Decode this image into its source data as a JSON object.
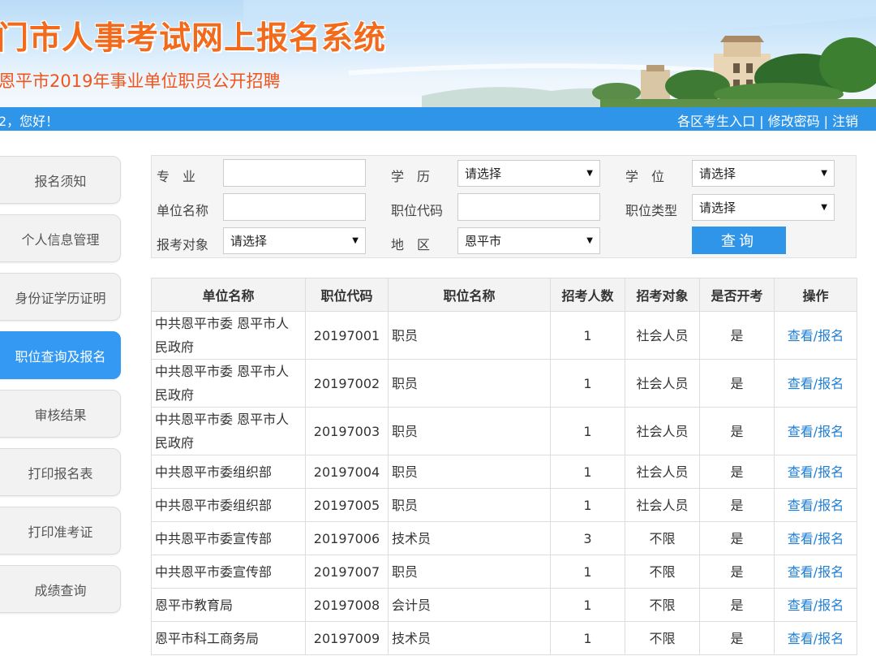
{
  "header": {
    "title": "门市人事考试网上报名系统",
    "subtitle": "恩平市2019年事业单位职员公开招聘"
  },
  "statusbar": {
    "greeting": "2，您好！",
    "links": [
      "各区考生入口",
      "修改密码",
      "注销"
    ],
    "separator": "|"
  },
  "sidebar": {
    "items": [
      {
        "label": "报名须知"
      },
      {
        "label": "个人信息管理"
      },
      {
        "label": "身份证学历证明"
      },
      {
        "label": "职位查询及报名",
        "active": true
      },
      {
        "label": "审核结果"
      },
      {
        "label": "打印报名表"
      },
      {
        "label": "打印准考证"
      },
      {
        "label": "成绩查询"
      }
    ]
  },
  "search": {
    "major_label": "专　业",
    "education_label": "学　历",
    "degree_label": "学　位",
    "unit_label": "单位名称",
    "position_code_label": "职位代码",
    "position_type_label": "职位类型",
    "target_label": "报考对象",
    "region_label": "地　区",
    "major_value": "",
    "unit_value": "",
    "position_code_value": "",
    "education_value": "请选择",
    "degree_value": "请选择",
    "position_type_value": "请选择",
    "target_value": "请选择",
    "region_value": "恩平市",
    "query_button": "查询"
  },
  "table": {
    "headers": [
      "单位名称",
      "职位代码",
      "职位名称",
      "招考人数",
      "招考对象",
      "是否开考",
      "操作"
    ],
    "rows": [
      {
        "unit": "中共恩平市委 恩平市人民政府",
        "code": "20197001",
        "position": "职员",
        "count": "1",
        "target": "社会人员",
        "open": "是",
        "action": "查看/报名"
      },
      {
        "unit": "中共恩平市委 恩平市人民政府",
        "code": "20197002",
        "position": "职员",
        "count": "1",
        "target": "社会人员",
        "open": "是",
        "action": "查看/报名"
      },
      {
        "unit": "中共恩平市委 恩平市人民政府",
        "code": "20197003",
        "position": "职员",
        "count": "1",
        "target": "社会人员",
        "open": "是",
        "action": "查看/报名"
      },
      {
        "unit": "中共恩平市委组织部",
        "code": "20197004",
        "position": "职员",
        "count": "1",
        "target": "社会人员",
        "open": "是",
        "action": "查看/报名"
      },
      {
        "unit": "中共恩平市委组织部",
        "code": "20197005",
        "position": "职员",
        "count": "1",
        "target": "社会人员",
        "open": "是",
        "action": "查看/报名"
      },
      {
        "unit": "中共恩平市委宣传部",
        "code": "20197006",
        "position": "技术员",
        "count": "3",
        "target": "不限",
        "open": "是",
        "action": "查看/报名"
      },
      {
        "unit": "中共恩平市委宣传部",
        "code": "20197007",
        "position": "职员",
        "count": "1",
        "target": "不限",
        "open": "是",
        "action": "查看/报名"
      },
      {
        "unit": "恩平市教育局",
        "code": "20197008",
        "position": "会计员",
        "count": "1",
        "target": "不限",
        "open": "是",
        "action": "查看/报名"
      },
      {
        "unit": "恩平市科工商务局",
        "code": "20197009",
        "position": "技术员",
        "count": "1",
        "target": "不限",
        "open": "是",
        "action": "查看/报名"
      }
    ]
  }
}
